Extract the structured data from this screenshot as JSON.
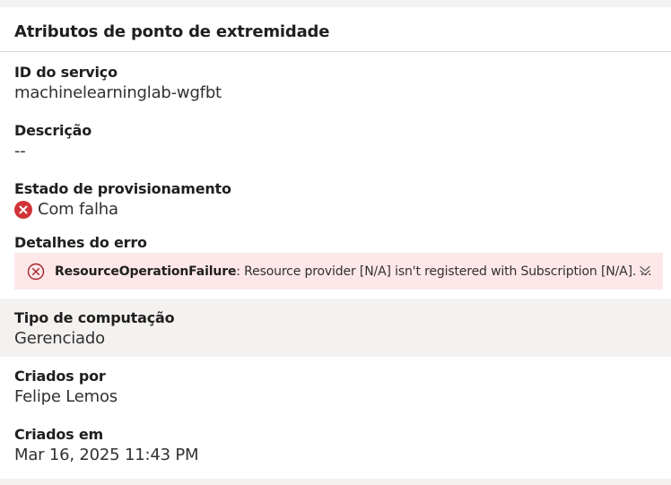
{
  "panel": {
    "title": "Atributos de ponto de extremidade"
  },
  "fields": {
    "service_id": {
      "label": "ID do serviço",
      "value": "machinelearninglab-wgfbt"
    },
    "description": {
      "label": "Descrição",
      "value": "--"
    },
    "provisioning": {
      "label": "Estado de provisionamento",
      "value": "Com falha",
      "icon": "error-circle-icon",
      "status_color": "#d13438"
    },
    "error": {
      "label": "Detalhes do erro",
      "code": "ResourceOperationFailure",
      "message": ": Resource provider [N/A] isn't registered with Subscription [N/A]. ...",
      "icon": "error-circle-outline-icon",
      "expand_icon": "chevron-double-down-icon",
      "background": "#fde7e9"
    },
    "compute_type": {
      "label": "Tipo de computação",
      "value": "Gerenciado"
    },
    "created_by": {
      "label": "Criados por",
      "value": "Felipe Lemos"
    },
    "created_on": {
      "label": "Criados em",
      "value": "Mar 16, 2025 11:43 PM"
    }
  }
}
